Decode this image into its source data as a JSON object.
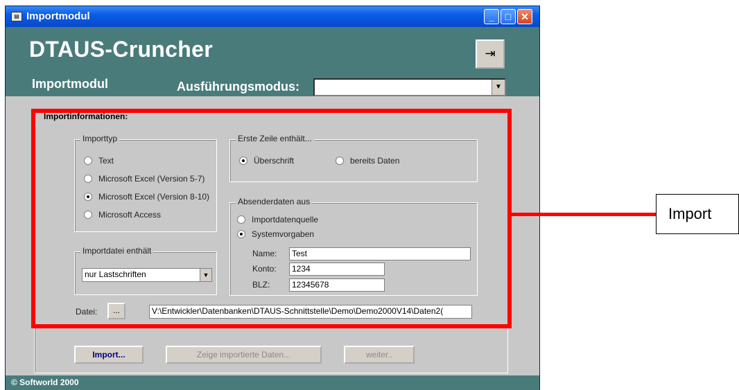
{
  "window": {
    "title": "Importmodul",
    "app_title": "DTAUS-Cruncher",
    "module_label": "Importmodul",
    "mode_label": "Ausführungsmodus:",
    "mode_value": ""
  },
  "panel": {
    "title": "Importinformationen:",
    "importtyp": {
      "label": "Importtyp",
      "options": [
        "Text",
        "Microsoft Excel (Version 5-7)",
        "Microsoft Excel (Version 8-10)",
        "Microsoft Access"
      ],
      "selected_index": 2
    },
    "erste_zeile": {
      "label": "Erste Zeile enthält...",
      "options": [
        "Überschrift",
        "bereits Daten"
      ],
      "selected_index": 0
    },
    "absender": {
      "label": "Absenderdaten aus",
      "options": [
        "Importdatenquelle",
        "Systemvorgaben"
      ],
      "selected_index": 1,
      "name_label": "Name:",
      "name_value": "Test",
      "konto_label": "Konto:",
      "konto_value": "1234",
      "blz_label": "BLZ:",
      "blz_value": "12345678"
    },
    "importdatei": {
      "label": "Importdatei enthält",
      "value": "nur Lastschriften"
    },
    "datei": {
      "label": "Datei:",
      "browse_label": "...",
      "path": "V:\\Entwickler\\Datenbanken\\DTAUS-Schnittstelle\\Demo\\Demo2000V14\\Daten2("
    }
  },
  "buttons": {
    "import": "Import...",
    "zeige": "Zeige importierte Daten...",
    "weiter": "weiter.."
  },
  "status": "©  Softworld 2000",
  "callout": "Import",
  "colors": {
    "header": "#4a7b7b",
    "title_bar": "#0a5ce8",
    "highlight": "#ff0000",
    "body": "#c8c8c8"
  }
}
